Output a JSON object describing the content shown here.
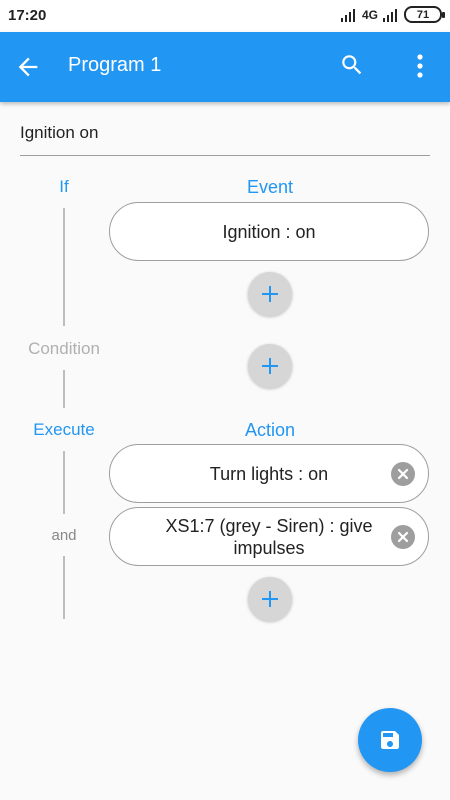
{
  "status_bar": {
    "time": "17:20",
    "network": "4G",
    "battery": "71"
  },
  "app_bar": {
    "title": "Program 1",
    "back_icon": "arrow-back-icon",
    "search_icon": "search-icon",
    "menu_icon": "more-vert-icon",
    "color": "#2196f3"
  },
  "program_name": "Ignition on",
  "if_section": {
    "label": "If",
    "column_header": "Event",
    "events": [
      {
        "text": "Ignition : on"
      }
    ],
    "add_icon": "plus-icon"
  },
  "condition_section": {
    "label": "Condition",
    "add_icon": "plus-icon"
  },
  "execute_section": {
    "label": "Execute",
    "column_header": "Action",
    "joiner": "and",
    "actions": [
      {
        "text": "Turn lights : on",
        "remove_icon": "clear-icon"
      },
      {
        "text": "XS1:7 (grey - Siren) : give impulses",
        "remove_icon": "clear-icon"
      }
    ],
    "add_icon": "plus-icon"
  },
  "fab": {
    "icon": "save-icon",
    "color": "#2196f3"
  }
}
